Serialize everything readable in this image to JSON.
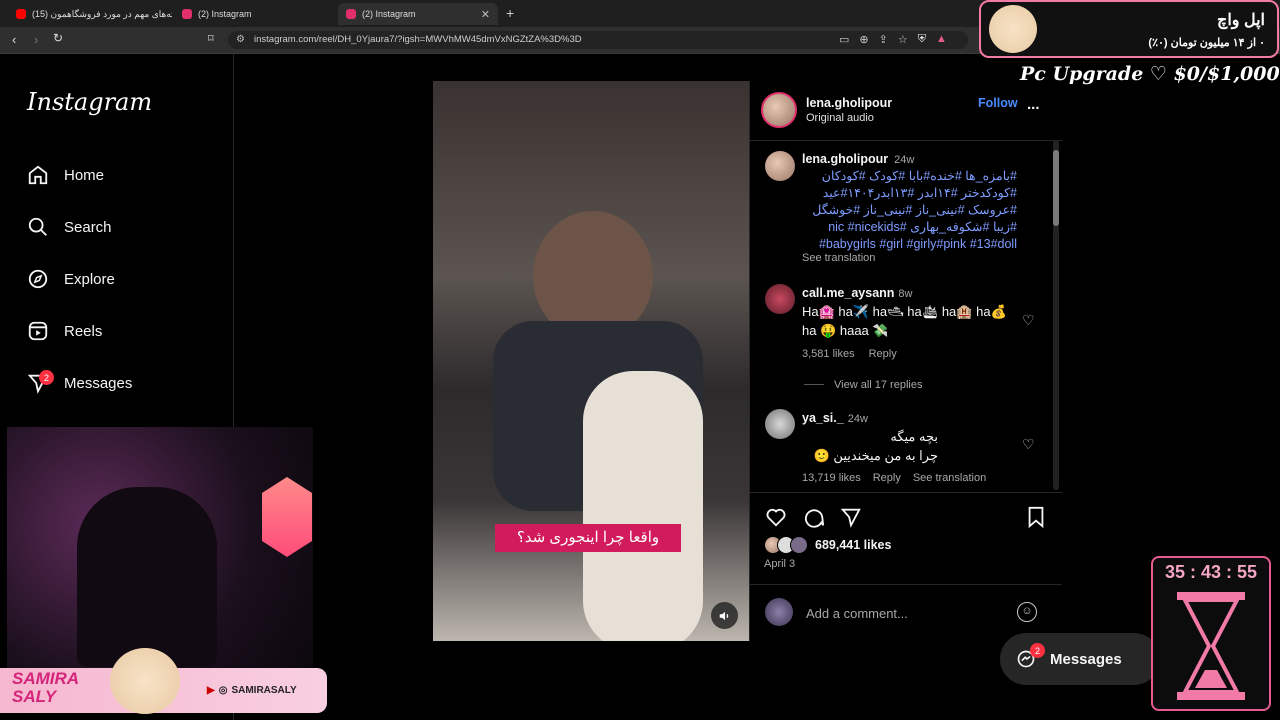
{
  "browser": {
    "tabs": [
      {
        "label": "(15) نکته‌های مهم در مورد فروشگاهمون",
        "color": "#ff0000"
      },
      {
        "label": "(2) Instagram",
        "color": "#e1306c"
      },
      {
        "label": "(2) Instagram",
        "color": "#e1306c"
      }
    ],
    "new_tab": "+",
    "url": "instagram.com/reel/DH_0Yjaura7/?igsh=MWVhMW45dmVxNGZtZA%3D%3D"
  },
  "sidebar": {
    "logo": "Instagram",
    "items": [
      {
        "label": "Home",
        "icon": "home-icon"
      },
      {
        "label": "Search",
        "icon": "search-icon"
      },
      {
        "label": "Explore",
        "icon": "compass-icon"
      },
      {
        "label": "Reels",
        "icon": "reels-icon"
      },
      {
        "label": "Messages",
        "icon": "messenger-icon",
        "badge": "2"
      }
    ]
  },
  "reel": {
    "caption_overlay": "واقعا چرا اینجوری شد؟"
  },
  "post": {
    "author": "lena.gholipour",
    "audio": "Original audio",
    "follow_label": "Follow",
    "more": "...",
    "description": {
      "user": "lena.gholipour",
      "time": "24w",
      "text": "#بامزه_ها #خنده#بابا #کودک #کودکان #کودکدختر #۱۴ابدر #۱۳ابدر۱۴۰۴#عید #عروسک #نینی_ناز #نینی_ناز #خوشگل #زیبا #شکوفه_بهاری #nic #nicekids #babygirls #girl #girly#pink #13#doll",
      "see_translation": "See translation"
    },
    "comments": [
      {
        "user": "call.me_aysann",
        "time": "8w",
        "text_line1": "Ha🏩 ha✈️ ha🛥 ha🛳 ha🏨 ha💰",
        "text_line2": "ha 🤑 haaa 💸",
        "likes": "3,581 likes",
        "reply": "Reply"
      },
      {
        "user": "ya_si._",
        "time": "24w",
        "text_line1": "بچه میگه",
        "text_line2": "چرا به من میخندیین 🙂",
        "likes": "13,719 likes",
        "reply": "Reply",
        "see_translation": "See translation"
      }
    ],
    "view_replies": "View all 17 replies",
    "likes": "689,441 likes",
    "date": "April 3",
    "add_comment_placeholder": "Add a comment..."
  },
  "overlay": {
    "top_right_title": "اپل واچ",
    "top_right_sub": "۰ از ۱۴ میلیون تومان (۰٪)",
    "goal": "Pc Upgrade ♡ $0/$1,000",
    "timer": "35 : 43 : 55",
    "streamer_name": "SAMIRA SALY",
    "streamer_handle": "SAMIRASALY"
  },
  "floating_messages": {
    "label": "Messages",
    "badge": "2"
  }
}
